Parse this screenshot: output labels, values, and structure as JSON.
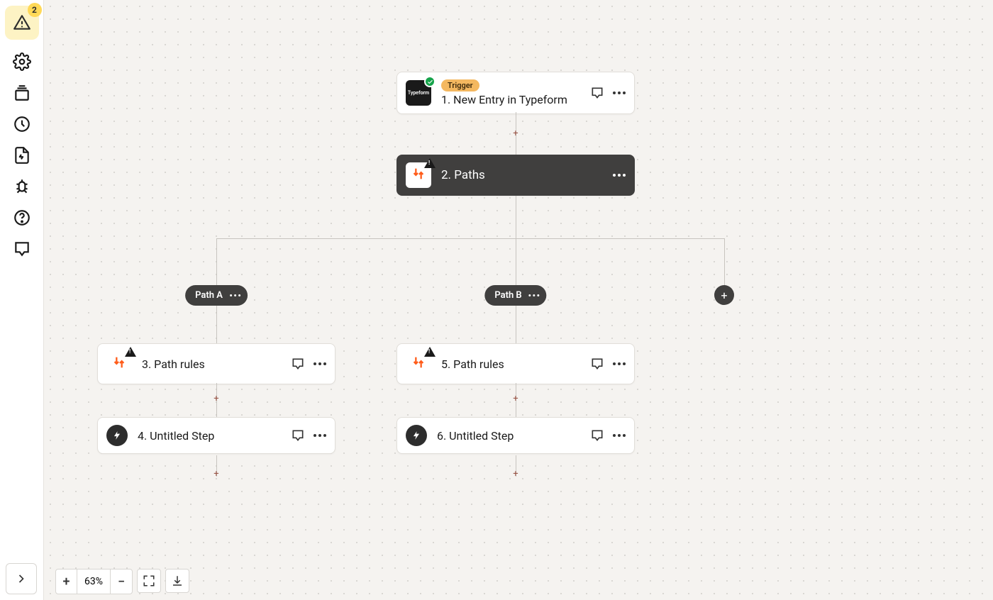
{
  "sidebar": {
    "alert_count": "2"
  },
  "zoom": {
    "level": "63%"
  },
  "nodes": {
    "trigger": {
      "pill": "Trigger",
      "title": "1. New Entry in Typeform",
      "app_label": "Typeform"
    },
    "paths": {
      "title": "2. Paths"
    },
    "path_a": {
      "label": "Path A"
    },
    "path_b": {
      "label": "Path B"
    },
    "step3": {
      "title": "3. Path rules"
    },
    "step4": {
      "title": "4. Untitled Step"
    },
    "step5": {
      "title": "5. Path rules"
    },
    "step6": {
      "title": "6. Untitled Step"
    }
  }
}
